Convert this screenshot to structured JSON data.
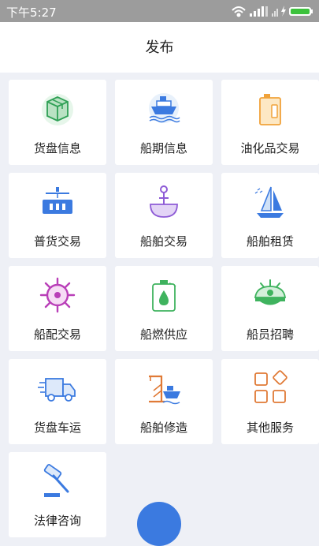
{
  "status": {
    "time": "下午5:27"
  },
  "header": {
    "title": "发布"
  },
  "grid": [
    {
      "label": "货盘信息",
      "icon": "cargo-box-icon"
    },
    {
      "label": "船期信息",
      "icon": "ship-schedule-icon"
    },
    {
      "label": "油化品交易",
      "icon": "oil-drum-icon"
    },
    {
      "label": "普货交易",
      "icon": "container-crane-icon"
    },
    {
      "label": "船舶交易",
      "icon": "anchor-icon"
    },
    {
      "label": "船舶租赁",
      "icon": "sailboat-icon"
    },
    {
      "label": "船配交易",
      "icon": "ship-wheel-icon"
    },
    {
      "label": "船燃供应",
      "icon": "fuel-can-icon"
    },
    {
      "label": "船员招聘",
      "icon": "captain-hat-icon"
    },
    {
      "label": "货盘车运",
      "icon": "truck-icon"
    },
    {
      "label": "船舶修造",
      "icon": "shipyard-crane-icon"
    },
    {
      "label": "其他服务",
      "icon": "apps-grid-icon"
    },
    {
      "label": "法律咨询",
      "icon": "gavel-icon"
    }
  ],
  "colors": {
    "accent": "#3b7ae0",
    "statusbar": "#9c9c9c",
    "background": "#eef0f6"
  }
}
